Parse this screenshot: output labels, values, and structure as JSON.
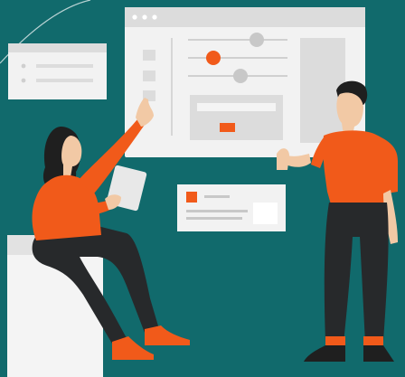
{
  "scene": {
    "background": "#116a6c",
    "accent": "#f15a1a",
    "panel_color": "#f2f2f2",
    "panel_mid": "#dcdcdc",
    "panel_dark": "#c8c8c8",
    "skin": "#f2c9a5",
    "hair": "#1f1f1f",
    "trousers": "#27292b",
    "tablet": "#e8e8e8"
  },
  "icons": {
    "window_controls": "three-dots-icon",
    "slider_knob": "circle-knob-icon",
    "toggle": "toggle-switch-icon"
  }
}
